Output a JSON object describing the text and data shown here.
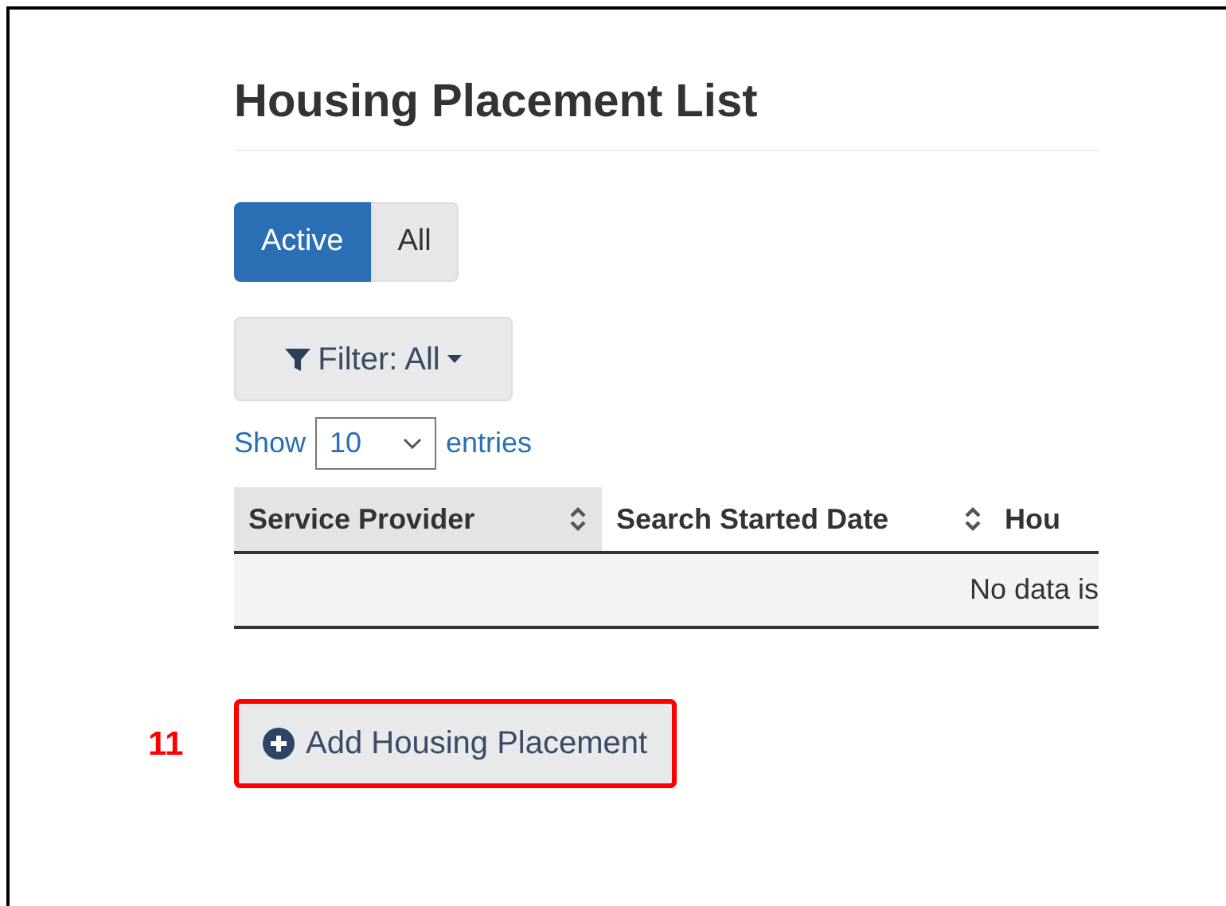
{
  "title": "Housing Placement List",
  "toggle": [
    {
      "label": "Active",
      "selected": true
    },
    {
      "label": "All",
      "selected": false
    }
  ],
  "filter_button": {
    "label": "Filter: All"
  },
  "length_control": {
    "before": "Show",
    "value": "10",
    "after": "entries"
  },
  "table": {
    "columns": [
      {
        "label": "Service Provider",
        "sorted": true
      },
      {
        "label": "Search Started Date",
        "sorted": false
      },
      {
        "label": "Hou",
        "sorted": false
      }
    ],
    "empty_message": "No data is"
  },
  "add_button": {
    "label": "Add Housing Placement"
  },
  "annotation": {
    "number": "11"
  }
}
